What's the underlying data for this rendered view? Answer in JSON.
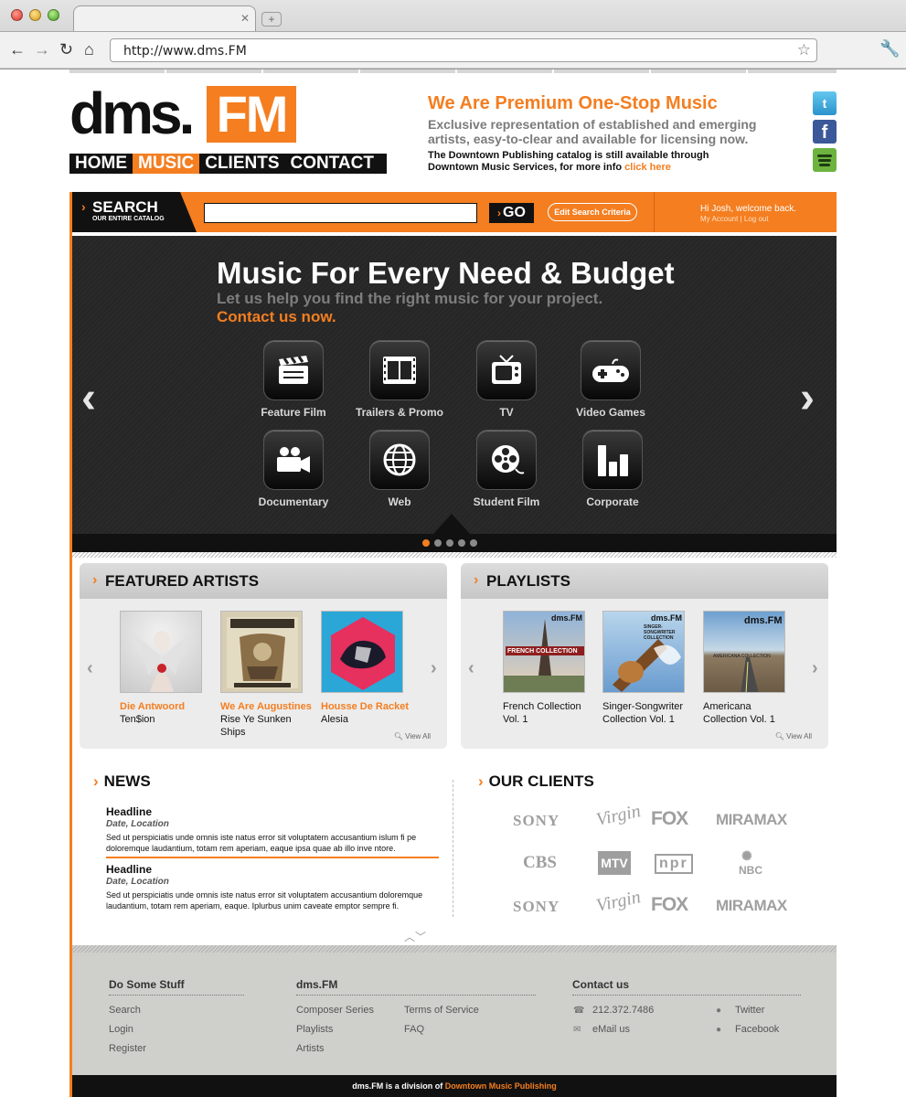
{
  "browser": {
    "tab_title": "",
    "url": "http://www.dms.FM"
  },
  "header": {
    "logo_text": "dms.",
    "logo_highlight": "FM",
    "nav": [
      {
        "label": "HOME",
        "active": false
      },
      {
        "label": "MUSIC",
        "active": true
      },
      {
        "label": "CLIENTS",
        "active": false
      },
      {
        "label": "CONTACT",
        "active": false
      }
    ],
    "promo_title": "We Are Premium One-Stop Music",
    "promo_sub": "Exclusive representation of established and emerging artists, easy-to-clear and available for licensing now.",
    "promo_note": "The Downtown Publishing catalog is still available through Downtown Music Services, for more info",
    "promo_link": "click here",
    "social": [
      "twitter-icon",
      "facebook-icon",
      "spotify-icon"
    ]
  },
  "search": {
    "label": "SEARCH",
    "sublabel": "OUR ENTIRE CATALOG",
    "value": "",
    "go_label": "GO",
    "edit_label": "Edit Search Criteria",
    "welcome": "Hi Josh, welcome back.",
    "account_link": "My Account",
    "logout_link": "Log out"
  },
  "hero": {
    "title": "Music For Every Need & Budget",
    "subtitle": "Let us help you find the right music for your project.",
    "cta": "Contact us now.",
    "categories": [
      {
        "label": "Feature Film",
        "icon": "clapperboard-icon"
      },
      {
        "label": "Trailers & Promo",
        "icon": "filmstrip-icon"
      },
      {
        "label": "TV",
        "icon": "tv-icon"
      },
      {
        "label": "Video Games",
        "icon": "gamepad-icon"
      },
      {
        "label": "Documentary",
        "icon": "video-camera-icon"
      },
      {
        "label": "Web",
        "icon": "globe-icon"
      },
      {
        "label": "Student Film",
        "icon": "film-reel-icon"
      },
      {
        "label": "Corporate",
        "icon": "bar-chart-icon"
      }
    ],
    "slides_total": 5,
    "slide_active": 1
  },
  "featured_artists": {
    "title": "FEATURED ARTISTS",
    "items": [
      {
        "artist": "Die Antwoord",
        "album": "Ten$ion"
      },
      {
        "artist": "We Are Augustines",
        "album": "Rise Ye Sunken Ships"
      },
      {
        "artist": "Housse De Racket",
        "album": "Alesia"
      }
    ],
    "view_all": "View All"
  },
  "playlists": {
    "title": "PLAYLISTS",
    "items": [
      {
        "title": "French Collection Vol. 1",
        "cover_brand": "dms.FM",
        "cover_text": "FRENCH COLLECTION"
      },
      {
        "title": "Singer-Songwriter Collection Vol. 1",
        "cover_brand": "dms.FM",
        "cover_text": "SINGER-SONGWRITER COLLECTION"
      },
      {
        "title": "Americana Collection Vol. 1",
        "cover_brand": "dms.FM",
        "cover_text": "AMERICANA COLLECTION"
      }
    ],
    "view_all": "View All"
  },
  "news": {
    "title": "NEWS",
    "items": [
      {
        "headline": "Headline",
        "meta": "Date, Location",
        "body": "Sed ut perspiciatis unde omnis iste natus error sit voluptatem accusantium islum fi pe doloremque laudantium, totam rem aperiam, eaque ipsa quae ab illo inve ntore."
      },
      {
        "headline": "Headline",
        "meta": "Date, Location",
        "body": "Sed ut perspiciatis unde omnis iste natus error sit voluptatem accusantium doloremque laudantium, totam rem aperiam, eaque. Iplurbus unim caveate emptor sempre fi."
      }
    ]
  },
  "clients": {
    "title": "OUR CLIENTS",
    "logos": [
      "SONY",
      "Virgin",
      "FOX",
      "MIRAMAX",
      "CBS",
      "MTV",
      "npr",
      "NBC",
      "SONY",
      "Virgin",
      "FOX",
      "MIRAMAX"
    ]
  },
  "footer": {
    "col1_title": "Do Some Stuff",
    "col1_links": [
      "Search",
      "Login",
      "Register"
    ],
    "col2_title": "dms.FM",
    "col2_links_a": [
      "Composer Series",
      "Playlists",
      "Artists"
    ],
    "col2_links_b": [
      "Terms of Service",
      "FAQ"
    ],
    "col3_title": "Contact us",
    "phone": "212.372.7486",
    "email": "eMail us",
    "twitter": "Twitter",
    "facebook": "Facebook",
    "division_text": "dms.FM is a division of",
    "division_link": "Downtown Music Publishing"
  },
  "colors": {
    "accent": "#f47e20",
    "dark": "#111111",
    "hero_bg": "#2a2a2a",
    "panel_bg": "#ececec",
    "footer_bg": "#cfcfcc"
  }
}
